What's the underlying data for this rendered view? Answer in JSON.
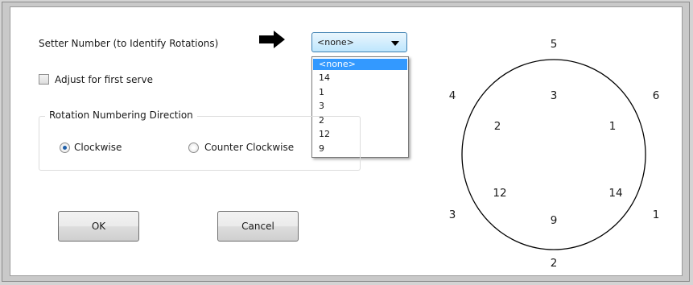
{
  "setter": {
    "label": "Setter Number (to Identify Rotations)",
    "selected": "<none>",
    "options": [
      "<none>",
      "14",
      "1",
      "3",
      "2",
      "12",
      "9"
    ]
  },
  "first_serve": {
    "label": "Adjust for first serve",
    "checked": false
  },
  "direction": {
    "legend": "Rotation Numbering Direction",
    "clockwise_label": "Clockwise",
    "counter_label": "Counter Clockwise",
    "selected": "Clockwise"
  },
  "buttons": {
    "ok": "OK",
    "cancel": "Cancel"
  },
  "rotation": {
    "outer": {
      "top": "5",
      "top_left": "4",
      "top_right": "6",
      "bottom_left": "3",
      "bottom_right": "1",
      "bottom": "2"
    },
    "inner": {
      "top": "3",
      "upper_left": "2",
      "upper_right": "1",
      "lower_left": "12",
      "lower_right": "14",
      "bottom": "9"
    }
  }
}
